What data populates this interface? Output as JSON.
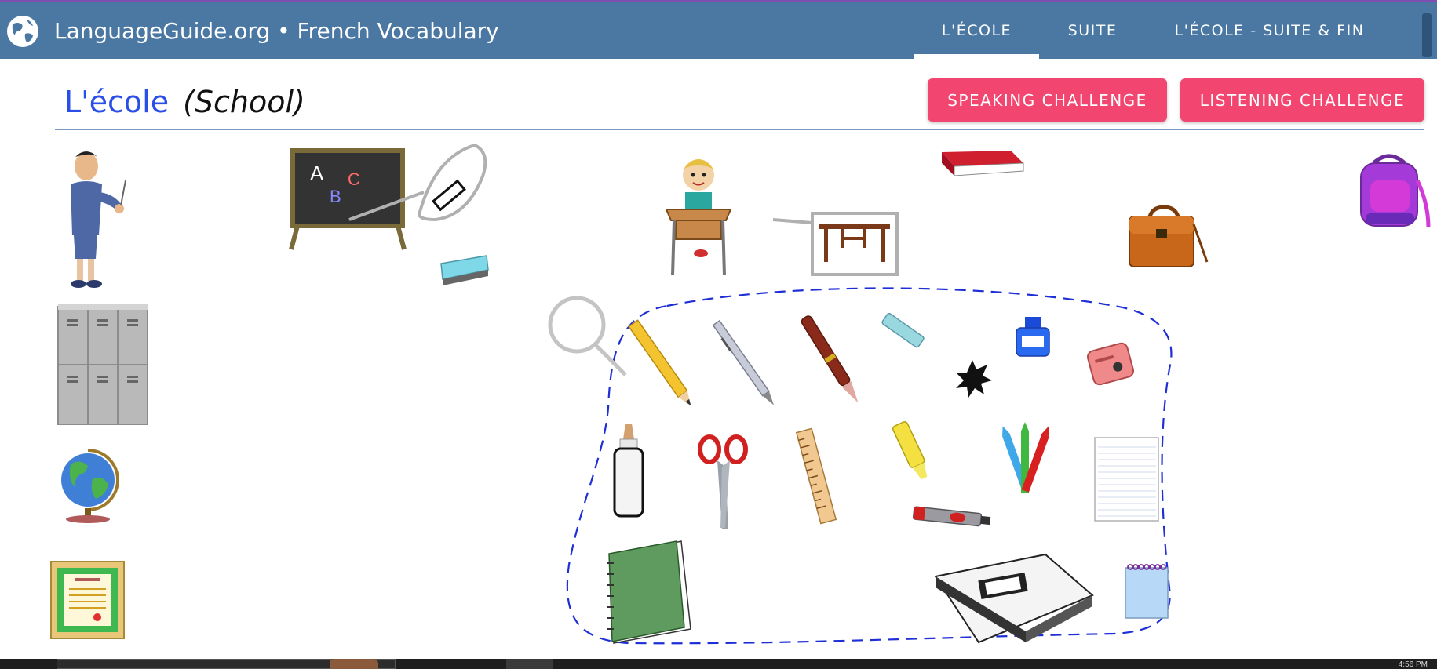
{
  "site": {
    "title": "LanguageGuide.org • French Vocabulary"
  },
  "nav": {
    "tabs": [
      {
        "label": "L'ÉCOLE",
        "active": true
      },
      {
        "label": "SUITE",
        "active": false
      },
      {
        "label": "L'ÉCOLE - SUITE & FIN",
        "active": false
      }
    ]
  },
  "page": {
    "heading_fr": "L'école",
    "heading_en": "(School)"
  },
  "buttons": {
    "speaking": "SPEAKING CHALLENGE",
    "listening": "LISTENING CHALLENGE"
  },
  "vocab_items": [
    "teacher",
    "blackboard",
    "chalk",
    "eraser",
    "student-at-desk",
    "desk",
    "book",
    "briefcase",
    "backpack",
    "lockers",
    "globe",
    "diploma",
    "pencil",
    "mechanical-pencil",
    "fountain-pen",
    "pencil-eraser",
    "ink-bottle",
    "ink-blot",
    "pencil-sharpener",
    "glue",
    "scissors",
    "ruler",
    "highlighter",
    "crayons",
    "marker",
    "notebook-paper",
    "spiral-notebook",
    "binder",
    "notepad"
  ],
  "colors": {
    "header": "#4a78a3",
    "header_accent": "#7e4fb1",
    "heading_fr": "#2a4fe6",
    "button": "#f2456f",
    "group_outline": "#1f2fd6"
  },
  "taskbar": {
    "clock": "4:56 PM"
  }
}
